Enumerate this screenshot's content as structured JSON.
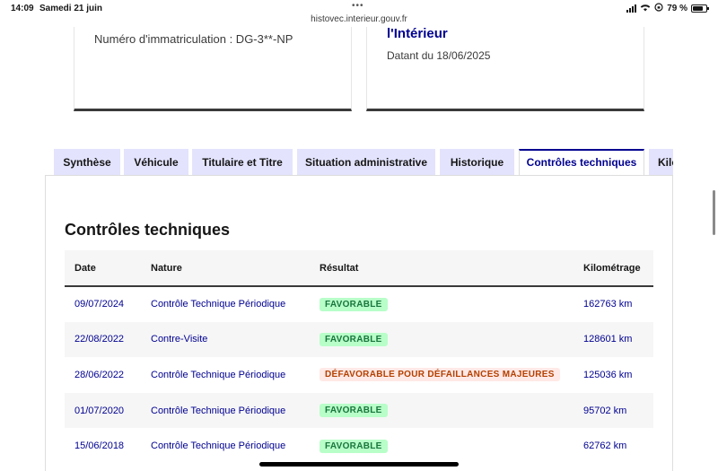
{
  "status_bar": {
    "time": "14:09",
    "date": "Samedi 21 juin",
    "url": "histovec.interieur.gouv.fr",
    "battery": "79 %",
    "battery_level": 0.79
  },
  "cards": {
    "left": {
      "plate": "Numéro d'immatriculation : DG-3**-NP"
    },
    "right": {
      "ministry": "l'Intérieur",
      "dated": "Datant du 18/06/2025"
    }
  },
  "tabs": [
    {
      "label": "Synthèse",
      "active": false
    },
    {
      "label": "Véhicule",
      "active": false
    },
    {
      "label": "Titulaire et Titre",
      "active": false
    },
    {
      "label": "Situation administrative",
      "active": false
    },
    {
      "label": "Historique",
      "active": false
    },
    {
      "label": "Contrôles techniques",
      "active": true
    },
    {
      "label": "Kilo",
      "active": false
    }
  ],
  "section": {
    "title": "Contrôles techniques",
    "columns": [
      "Date",
      "Nature",
      "Résultat",
      "Kilométrage"
    ],
    "rows": [
      {
        "date": "09/07/2024",
        "nature": "Contrôle Technique Périodique",
        "result": "FAVORABLE",
        "result_status": "ok",
        "km": "162763 km"
      },
      {
        "date": "22/08/2022",
        "nature": "Contre-Visite",
        "result": "FAVORABLE",
        "result_status": "ok",
        "km": "128601 km"
      },
      {
        "date": "28/06/2022",
        "nature": "Contrôle Technique Périodique",
        "result": "DÉFAVORABLE POUR DÉFAILLANCES MAJEURES",
        "result_status": "ko",
        "km": "125036 km"
      },
      {
        "date": "01/07/2020",
        "nature": "Contrôle Technique Périodique",
        "result": "FAVORABLE",
        "result_status": "ok",
        "km": "95702 km"
      },
      {
        "date": "15/06/2018",
        "nature": "Contrôle Technique Périodique",
        "result": "FAVORABLE",
        "result_status": "ok",
        "km": "62762 km"
      }
    ]
  },
  "colors": {
    "accent": "#000091",
    "tab_bg": "#e3e3fd",
    "ok_bg": "#b8fec9",
    "ok_text": "#18753c",
    "ko_bg": "#ffe9e6",
    "ko_text": "#b34000"
  }
}
